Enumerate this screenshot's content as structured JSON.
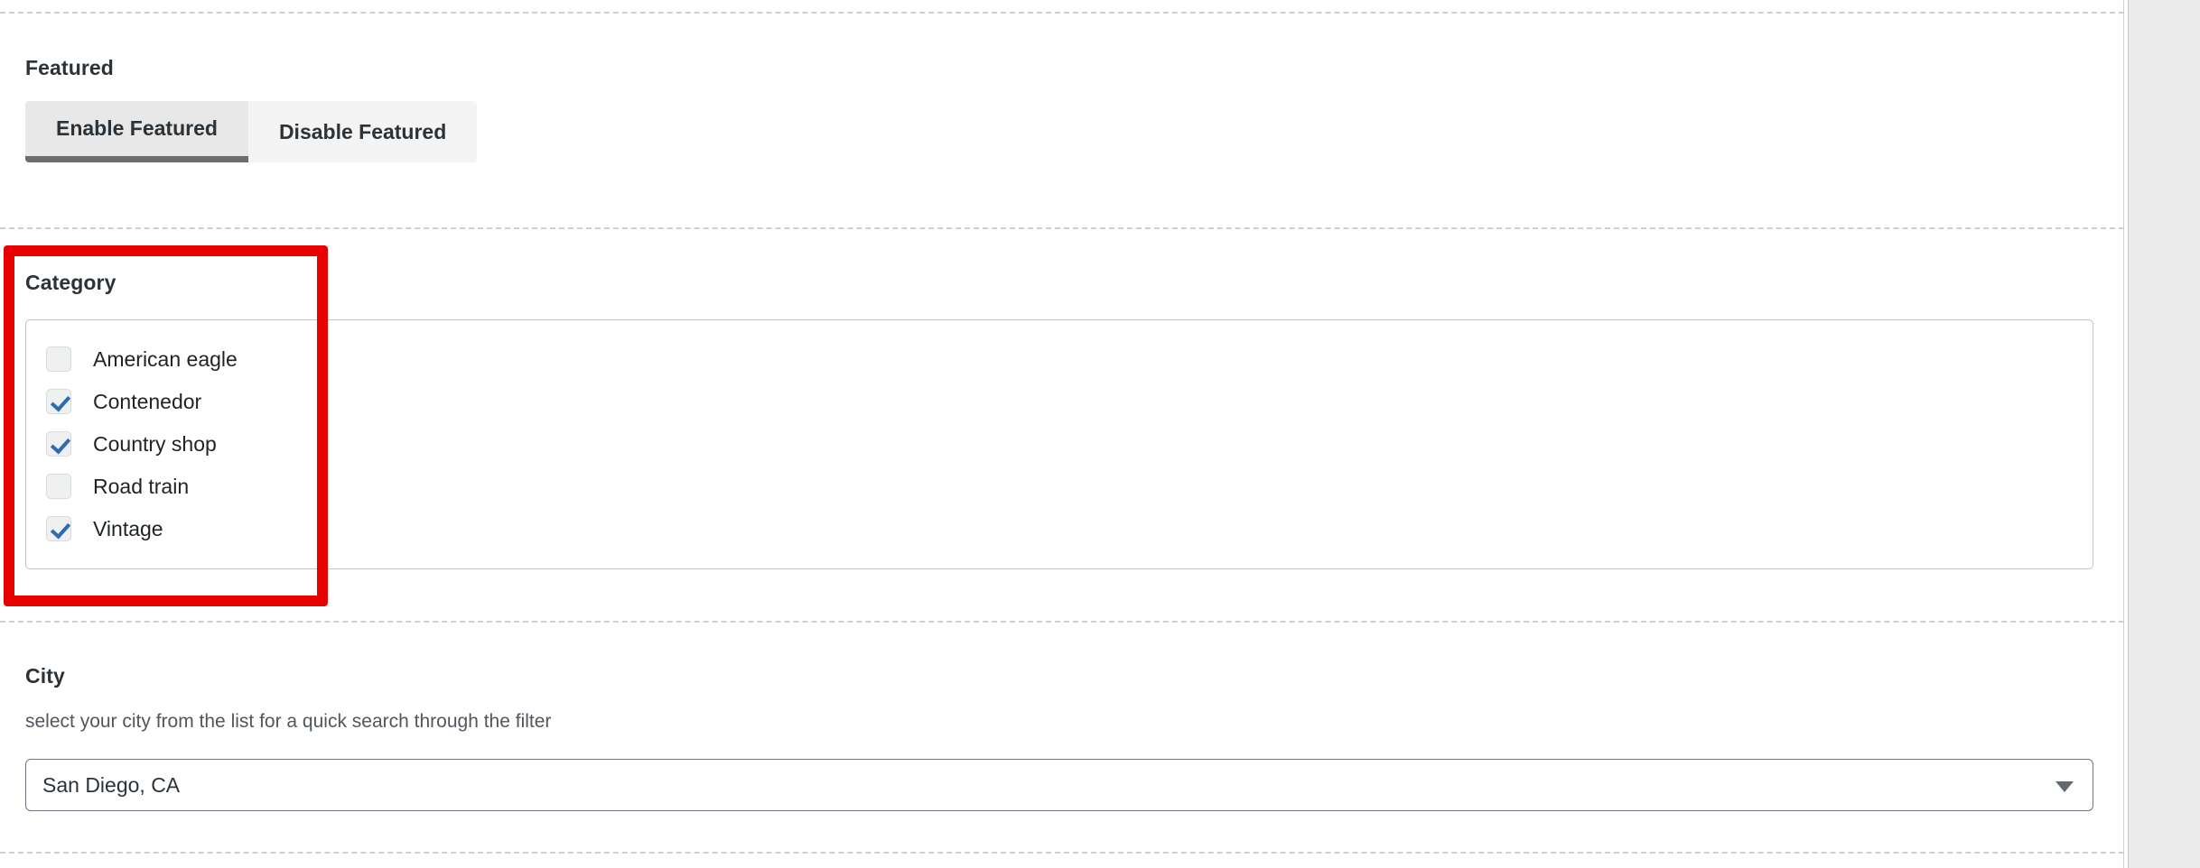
{
  "colors": {
    "highlight_red": "#e60000",
    "checkbox_check_blue": "#2b6cb5",
    "active_tab_underline": "#6d6d6d",
    "text_dark": "#1d2327",
    "text_muted": "#50575e",
    "gutter_gray": "#ebebeb"
  },
  "featured": {
    "label": "Featured",
    "tabs": [
      {
        "label": "Enable Featured",
        "active": true
      },
      {
        "label": "Disable Featured",
        "active": false
      }
    ]
  },
  "category": {
    "label": "Category",
    "items": [
      {
        "label": "American eagle",
        "checked": false
      },
      {
        "label": "Contenedor",
        "checked": true
      },
      {
        "label": "Country shop",
        "checked": true
      },
      {
        "label": "Road train",
        "checked": false
      },
      {
        "label": "Vintage",
        "checked": true
      }
    ]
  },
  "city": {
    "label": "City",
    "help": "select your city from the list for a quick search through the filter",
    "selected": "San Diego, CA",
    "options": [
      "San Diego, CA"
    ],
    "caret_icon": "chevron-down-icon"
  }
}
